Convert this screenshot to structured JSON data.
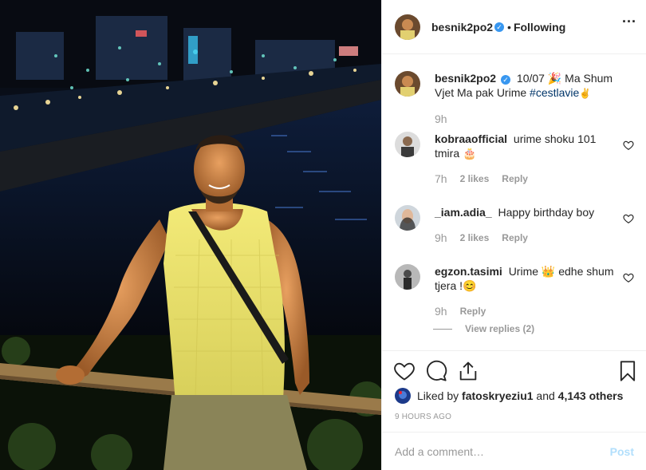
{
  "header": {
    "username": "besnik2po2",
    "verified": true,
    "separator": "•",
    "follow_status": "Following",
    "more_icon": "more-options-icon"
  },
  "caption": {
    "username": "besnik2po2",
    "text_before": "10/07 🎉 Ma Shum Vjet Ma pak Urime ",
    "hashtag": "#cestlavie",
    "text_after": " ✌️",
    "time": "9h"
  },
  "comments": [
    {
      "username": "kobraaofficial",
      "text": "urime shoku 101 tmira 🎂",
      "time": "7h",
      "likes": "2 likes",
      "reply": "Reply"
    },
    {
      "username": "_iam.adia_",
      "text": "Happy birthday boy",
      "time": "9h",
      "likes": "2 likes",
      "reply": "Reply"
    },
    {
      "username": "egzon.tasimi",
      "text": "Urime 👑 edhe shum tjera !😊",
      "time": "9h",
      "likes": "",
      "reply": "Reply"
    }
  ],
  "view_replies": "View replies (2)",
  "likes": {
    "prefix": "Liked by ",
    "user": "fatoskryeziu1",
    "middle": " and ",
    "count": "4,143 others"
  },
  "posted": "9 HOURS AGO",
  "add_comment": {
    "placeholder": "Add a comment…",
    "post_label": "Post"
  },
  "colors": {
    "link": "#003569",
    "verified": "#3897f0",
    "post_disabled": "#b2dffc",
    "muted": "#999999"
  }
}
